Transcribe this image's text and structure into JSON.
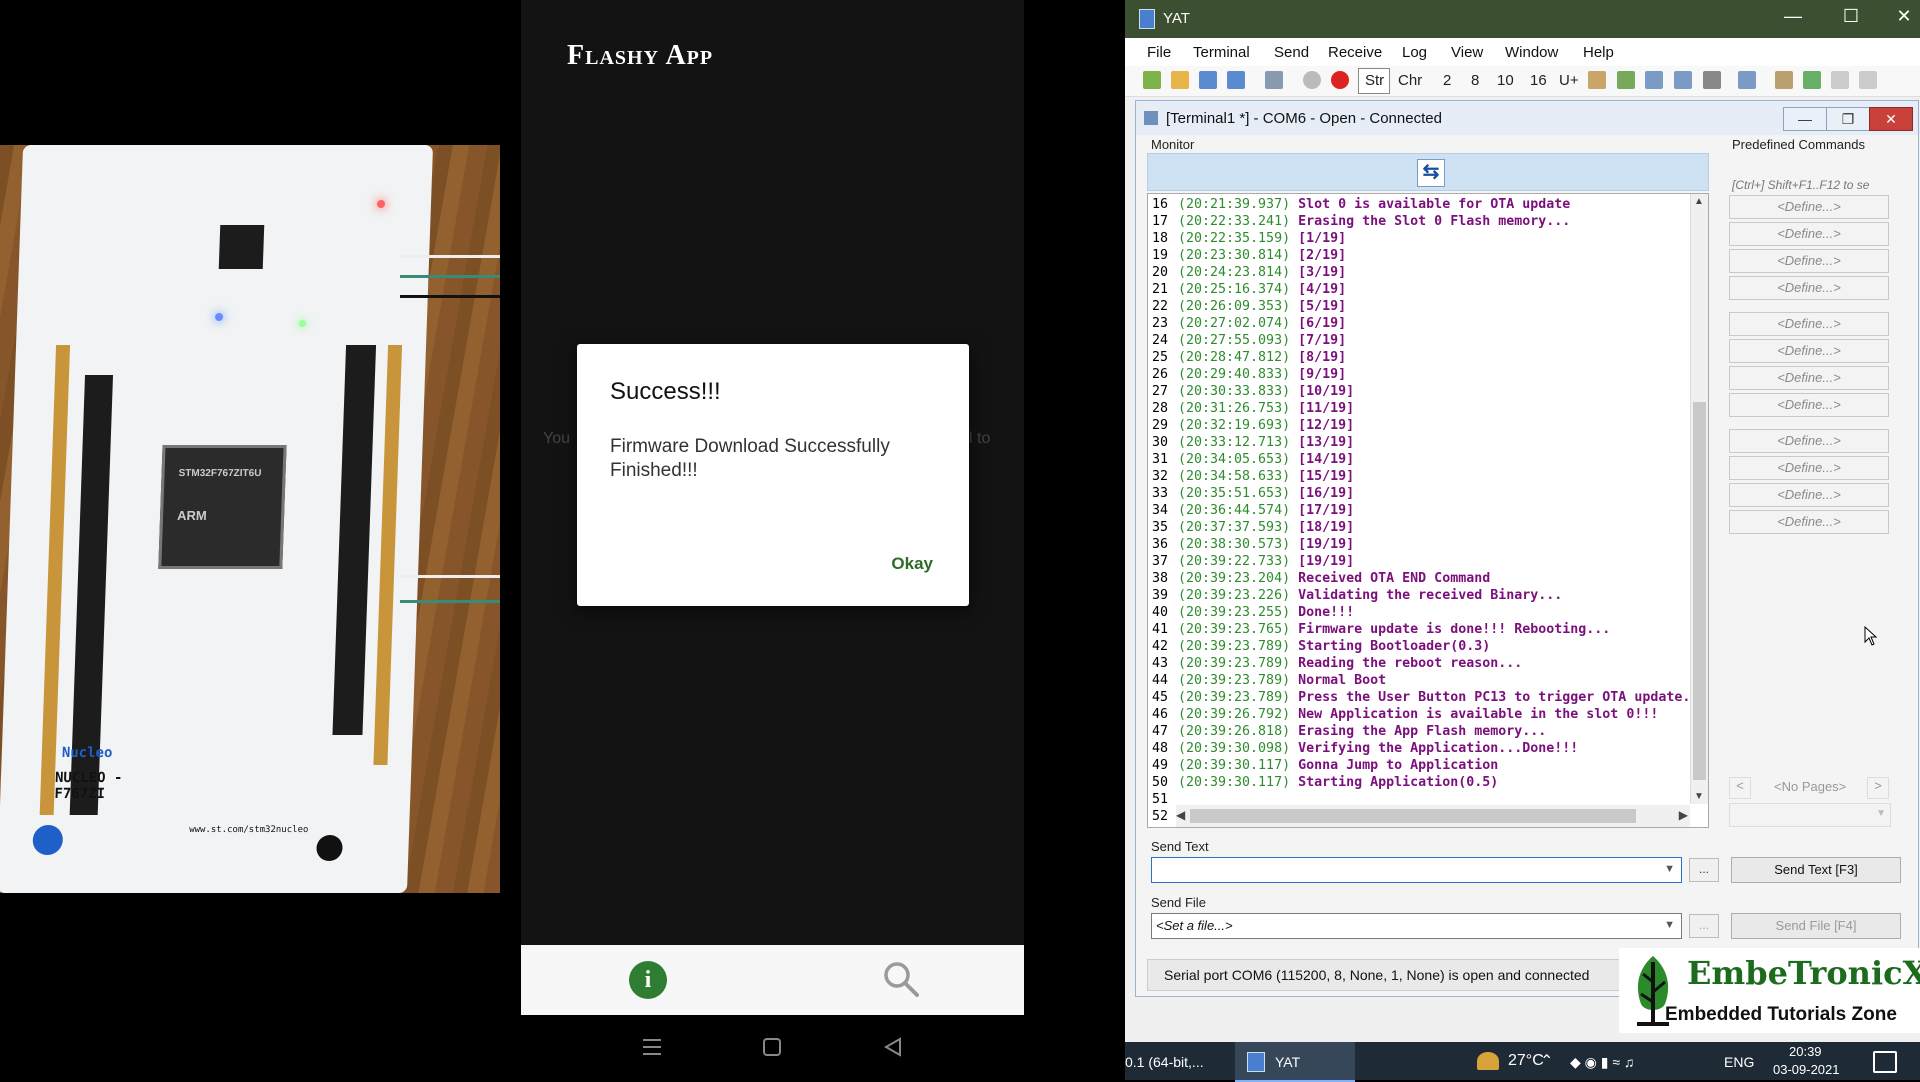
{
  "phone": {
    "app_title": "Flashy App",
    "bg_text_left": "You",
    "bg_text_right": "l to",
    "dialog": {
      "title": "Success!!!",
      "message": "Firmware Download Successfully Finished!!!",
      "ok_label": "Okay"
    },
    "bottom_nav": {
      "info_glyph": "i"
    }
  },
  "board": {
    "nucleo_label": "Nucleo",
    "model_label": "NUCLEO -F767ZI",
    "chip_lines": [
      "STM32F767ZIT6U",
      "ARM"
    ],
    "url": "www.st.com/stm32nucleo"
  },
  "yat": {
    "window_title": "YAT",
    "menu": [
      "File",
      "Terminal",
      "Send",
      "Receive",
      "Log",
      "View",
      "Window",
      "Help"
    ],
    "toolbar_text": [
      "Str",
      "Chr",
      "2",
      "8",
      "10",
      "16",
      "U+"
    ],
    "terminal": {
      "title": "[Terminal1 *] - COM6 - Open - Connected",
      "monitor_label": "Monitor",
      "lines": [
        {
          "n": "16",
          "ts": "(20:21:39.937)",
          "msg": "Slot 0 is available for OTA update"
        },
        {
          "n": "17",
          "ts": "(20:22:33.241)",
          "msg": "Erasing the Slot 0 Flash memory..."
        },
        {
          "n": "18",
          "ts": "(20:22:35.159)",
          "msg": "[1/19]"
        },
        {
          "n": "19",
          "ts": "(20:23:30.814)",
          "msg": "[2/19]"
        },
        {
          "n": "20",
          "ts": "(20:24:23.814)",
          "msg": "[3/19]"
        },
        {
          "n": "21",
          "ts": "(20:25:16.374)",
          "msg": "[4/19]"
        },
        {
          "n": "22",
          "ts": "(20:26:09.353)",
          "msg": "[5/19]"
        },
        {
          "n": "23",
          "ts": "(20:27:02.074)",
          "msg": "[6/19]"
        },
        {
          "n": "24",
          "ts": "(20:27:55.093)",
          "msg": "[7/19]"
        },
        {
          "n": "25",
          "ts": "(20:28:47.812)",
          "msg": "[8/19]"
        },
        {
          "n": "26",
          "ts": "(20:29:40.833)",
          "msg": "[9/19]"
        },
        {
          "n": "27",
          "ts": "(20:30:33.833)",
          "msg": "[10/19]"
        },
        {
          "n": "28",
          "ts": "(20:31:26.753)",
          "msg": "[11/19]"
        },
        {
          "n": "29",
          "ts": "(20:32:19.693)",
          "msg": "[12/19]"
        },
        {
          "n": "30",
          "ts": "(20:33:12.713)",
          "msg": "[13/19]"
        },
        {
          "n": "31",
          "ts": "(20:34:05.653)",
          "msg": "[14/19]"
        },
        {
          "n": "32",
          "ts": "(20:34:58.633)",
          "msg": "[15/19]"
        },
        {
          "n": "33",
          "ts": "(20:35:51.653)",
          "msg": "[16/19]"
        },
        {
          "n": "34",
          "ts": "(20:36:44.574)",
          "msg": "[17/19]"
        },
        {
          "n": "35",
          "ts": "(20:37:37.593)",
          "msg": "[18/19]"
        },
        {
          "n": "36",
          "ts": "(20:38:30.573)",
          "msg": "[19/19]"
        },
        {
          "n": "37",
          "ts": "(20:39:22.733)",
          "msg": "[19/19]"
        },
        {
          "n": "38",
          "ts": "(20:39:23.204)",
          "msg": "Received OTA END Command"
        },
        {
          "n": "39",
          "ts": "(20:39:23.226)",
          "msg": "Validating the received Binary..."
        },
        {
          "n": "40",
          "ts": "(20:39:23.255)",
          "msg": "Done!!!"
        },
        {
          "n": "41",
          "ts": "(20:39:23.765)",
          "msg": "Firmware update is done!!! Rebooting..."
        },
        {
          "n": "42",
          "ts": "(20:39:23.789)",
          "msg": "Starting Bootloader(0.3)"
        },
        {
          "n": "43",
          "ts": "(20:39:23.789)",
          "msg": "Reading the reboot reason..."
        },
        {
          "n": "44",
          "ts": "(20:39:23.789)",
          "msg": "Normal Boot"
        },
        {
          "n": "45",
          "ts": "(20:39:23.789)",
          "msg": "Press the User Button PC13 to trigger OTA update."
        },
        {
          "n": "46",
          "ts": "(20:39:26.792)",
          "msg": "New Application is available in the slot 0!!!"
        },
        {
          "n": "47",
          "ts": "(20:39:26.818)",
          "msg": "Erasing the App Flash memory..."
        },
        {
          "n": "48",
          "ts": "(20:39:30.098)",
          "msg": "Verifying the Application...Done!!!"
        },
        {
          "n": "49",
          "ts": "(20:39:30.117)",
          "msg": "Gonna Jump to Application"
        },
        {
          "n": "50",
          "ts": "(20:39:30.117)",
          "msg": "Starting Application(0.5)"
        },
        {
          "n": "51",
          "ts": "",
          "msg": ""
        },
        {
          "n": "52",
          "ts": "",
          "msg": ""
        }
      ],
      "predefined_title": "Predefined Commands",
      "predefined_hint": "[Ctrl+] Shift+F1..F12 to se",
      "define_label": "<Define...>",
      "no_pages": "<No Pages>",
      "send_text_label": "Send Text",
      "send_text_value": "",
      "send_text_button": "Send Text [F3]",
      "send_file_label": "Send File",
      "send_file_value": "<Set a file...>",
      "send_file_button": "Send File [F4]",
      "dots": "...",
      "status": "Serial port COM6 (115200, 8, None, 1, None) is open and connected"
    },
    "taskbar": {
      "left_item": "0.1 (64-bit,...",
      "app": "YAT",
      "weather": "27°C",
      "lang": "ENG",
      "time": "20:39",
      "date": "03-09-2021"
    }
  },
  "brand": {
    "name": "EmbeTronicX",
    "tagline": "Embedded Tutorials Zone"
  },
  "colors": {
    "dialog_ok": "#2e6d28",
    "timestamp": "#2e8b2e",
    "message": "#7b0f7b",
    "titlebar": "#3c4f30"
  }
}
